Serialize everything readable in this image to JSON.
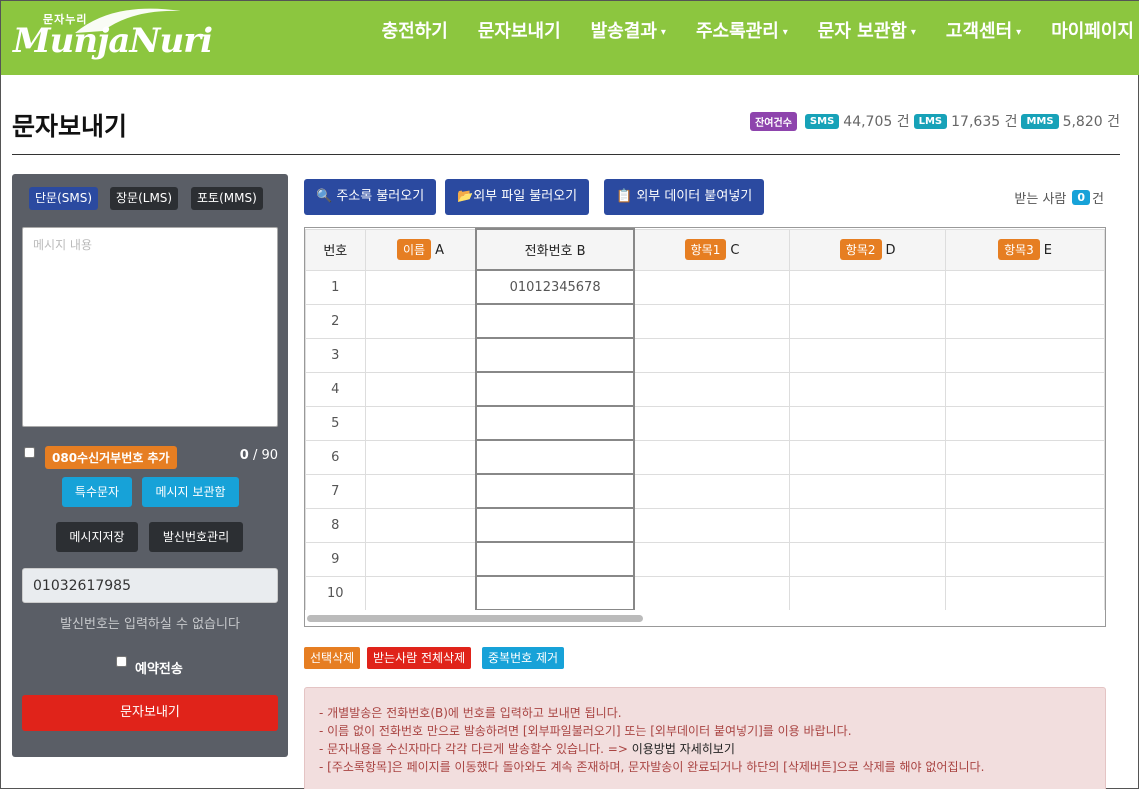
{
  "brand": {
    "logo_small": "문자누리",
    "logo_main": "MunjaNuri"
  },
  "nav": [
    {
      "label": "충전하기",
      "caret": false
    },
    {
      "label": "문자보내기",
      "caret": false
    },
    {
      "label": "발송결과",
      "caret": true
    },
    {
      "label": "주소록관리",
      "caret": true
    },
    {
      "label": "문자 보관함",
      "caret": true
    },
    {
      "label": "고객센터",
      "caret": true
    },
    {
      "label": "마이페이지",
      "caret": false
    }
  ],
  "page": {
    "title": "문자보내기"
  },
  "balance": {
    "remaining_label": "잔여건수",
    "sms_label": "SMS",
    "sms_value": "44,705 건",
    "lms_label": "LMS",
    "lms_value": "17,635 건",
    "mms_label": "MMS",
    "mms_value": "5,820 건"
  },
  "left": {
    "types": [
      "단문(SMS)",
      "장문(LMS)",
      "포토(MMS)"
    ],
    "message_placeholder": "메시지 내용",
    "optout_label": "080수신거부번호 추가",
    "char_count": "0",
    "char_max": " / 90",
    "special_btn": "특수문자",
    "storage_btn": "메시지 보관함",
    "save_btn": "메시지저장",
    "sender_mgmt_btn": "발신번호관리",
    "sender_number": "01032617985",
    "sender_note": "발신번호는 입력하실 수 없습니다",
    "reserve_label": "예약전송",
    "send_btn": "문자보내기"
  },
  "toolbar": {
    "address_btn": "주소록 불러오기",
    "file_btn": "외부 파일 불러오기",
    "paste_btn": "외부 데이터 붙여넣기",
    "recv_label": "받는 사람",
    "recv_count": "0",
    "recv_unit": "건"
  },
  "grid": {
    "headers": [
      {
        "tag": "",
        "text": "번호"
      },
      {
        "tag": "이름",
        "text": "A"
      },
      {
        "tag": "",
        "text": "전화번호 B"
      },
      {
        "tag": "항목1",
        "text": "C"
      },
      {
        "tag": "항목2",
        "text": "D"
      },
      {
        "tag": "항목3",
        "text": "E"
      }
    ],
    "rows": [
      {
        "num": "1",
        "phone": "01012345678"
      },
      {
        "num": "2",
        "phone": ""
      },
      {
        "num": "3",
        "phone": ""
      },
      {
        "num": "4",
        "phone": ""
      },
      {
        "num": "5",
        "phone": ""
      },
      {
        "num": "6",
        "phone": ""
      },
      {
        "num": "7",
        "phone": ""
      },
      {
        "num": "8",
        "phone": ""
      },
      {
        "num": "9",
        "phone": ""
      },
      {
        "num": "10",
        "phone": ""
      }
    ]
  },
  "actions": {
    "delete_selected": "선택삭제",
    "delete_all": "받는사람 전체삭제",
    "dedupe": "중복번호 제거"
  },
  "notice": [
    "- 개별발송은 전화번호(B)에 번호를 입력하고 보내면 됩니다.",
    "- 이름 없이 전화번호 만으로 발송하려면 [외부파일불러오기] 또는 [외부데이터 붙여넣기]를 이용 바랍니다.",
    "- 문자내용을 수신자마다 각각 다르게 발송할수 있습니다. => ",
    "- [주소록항목]은 페이지를 이동했다 돌아와도 계속 존재하며, 문자발송이 완료되거나 하단의 [삭제버튼]으로 삭제를 해야 없어집니다."
  ],
  "notice_link": "이용방법 자세히보기"
}
